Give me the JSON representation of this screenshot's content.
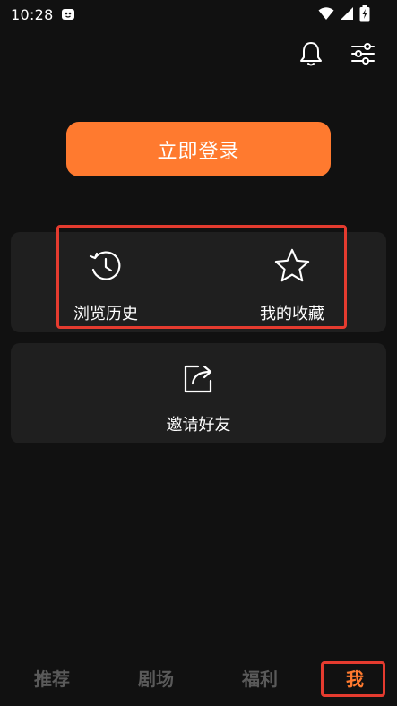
{
  "status_bar": {
    "time": "10:28",
    "icons": [
      "app-notification-icon",
      "wifi-icon",
      "signal-icon",
      "battery-charging-icon"
    ]
  },
  "top_actions": {
    "icons": [
      "bell-icon",
      "settings-sliders-icon"
    ]
  },
  "login": {
    "label": "立即登录"
  },
  "quick_actions": {
    "history_label": "浏览历史",
    "favorite_label": "我的收藏"
  },
  "invite": {
    "label": "邀请好友"
  },
  "bottom_nav": {
    "tabs": [
      {
        "label": "推荐"
      },
      {
        "label": "剧场"
      },
      {
        "label": "福利"
      },
      {
        "label": "我"
      }
    ],
    "active_index": 3
  },
  "colors": {
    "background": "#111111",
    "card": "#1f1f1f",
    "accent": "#ff7a2f",
    "highlight": "#e53b2f",
    "inactive_tab": "#5a5a5a"
  }
}
